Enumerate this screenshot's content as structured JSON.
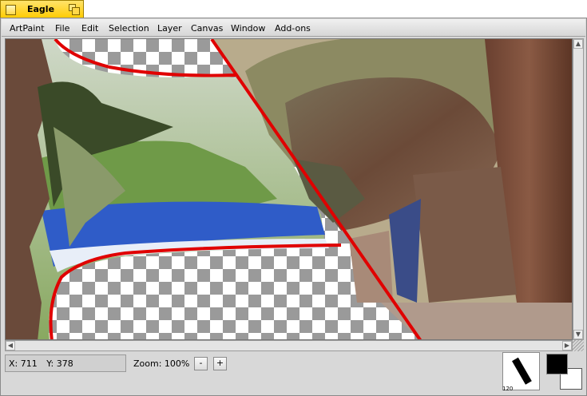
{
  "window": {
    "title": "Eagle"
  },
  "menubar": {
    "items": [
      "ArtPaint",
      "File",
      "Edit",
      "Selection",
      "Layer",
      "Canvas",
      "Window",
      "Add-ons"
    ]
  },
  "canvas": {
    "description_icon": "photo-layer",
    "selection_color": "#e00000",
    "transparency_check_color": "#9a9a9a"
  },
  "status": {
    "x_label": "X: 711",
    "y_label": "Y: 378",
    "zoom_label": "Zoom: 100%",
    "zoom_out": "-",
    "zoom_in": "+"
  },
  "tools": {
    "brush_icon": "brush-preview-icon",
    "brush_size": "120",
    "foreground_color": "#000000",
    "background_color": "#ffffff"
  },
  "scrollbars": {
    "up_glyph": "▲",
    "down_glyph": "▼",
    "left_glyph": "◀",
    "right_glyph": "▶"
  }
}
